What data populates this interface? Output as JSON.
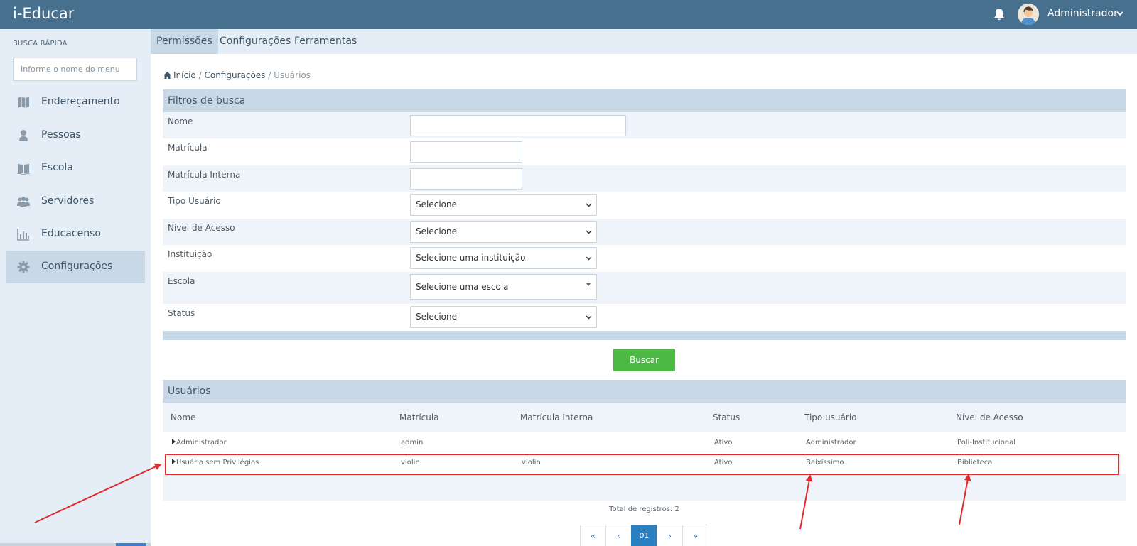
{
  "app": {
    "title": "i-Educar"
  },
  "header": {
    "user_name": "Administrador",
    "bell_icon": "bell-icon",
    "avatar_icon": "avatar"
  },
  "sidebar": {
    "quick_label": "BUSCA RÁPIDA",
    "quick_placeholder": "Informe o nome do menu",
    "items": [
      {
        "label": "Endereçamento",
        "icon": "map-icon"
      },
      {
        "label": "Pessoas",
        "icon": "person-icon"
      },
      {
        "label": "Escola",
        "icon": "book-icon"
      },
      {
        "label": "Servidores",
        "icon": "users-icon"
      },
      {
        "label": "Educacenso",
        "icon": "bar-chart-icon"
      },
      {
        "label": "Configurações",
        "icon": "gear-icon",
        "active": true
      }
    ]
  },
  "menu": {
    "items": [
      {
        "label": "Permissões",
        "active": true
      },
      {
        "label": "Configurações"
      },
      {
        "label": "Ferramentas"
      }
    ]
  },
  "breadcrumb": {
    "home": "Início",
    "sep1": "/",
    "section": "Configurações",
    "sep2": "/",
    "current": "Usuários"
  },
  "filters": {
    "title": "Filtros de busca",
    "nome_label": "Nome",
    "matricula_label": "Matrícula",
    "matricula_interna_label": "Matrícula Interna",
    "tipo_usuario_label": "Tipo Usuário",
    "tipo_usuario_value": "Selecione",
    "nivel_acesso_label": "Nível de Acesso",
    "nivel_acesso_value": "Selecione",
    "instituicao_label": "Instituição",
    "instituicao_value": "Selecione uma instituição",
    "escola_label": "Escola",
    "escola_value": "Selecione uma escola",
    "status_label": "Status",
    "status_value": "Selecione",
    "search_button": "Buscar"
  },
  "users_table": {
    "title": "Usuários",
    "headers": [
      "Nome",
      "Matrícula",
      "Matrícula Interna",
      "Status",
      "Tipo usuário",
      "Nível de Acesso"
    ],
    "rows": [
      {
        "nome": "Administrador",
        "matricula": "admin",
        "matricula_interna": "",
        "status": "Ativo",
        "tipo": "Administrador",
        "nivel": "Poli-Institucional"
      },
      {
        "nome": "Usuário sem Privilégios",
        "matricula": "violin",
        "matricula_interna": "violin",
        "status": "Ativo",
        "tipo": "Baixíssimo",
        "nivel": "Biblioteca"
      }
    ],
    "total": "Total de registros: 2"
  },
  "pagination": {
    "first": "«",
    "prev": "‹",
    "current": "01",
    "next": "›",
    "last": "»"
  },
  "annotation": {
    "color": "#e22a2a"
  }
}
